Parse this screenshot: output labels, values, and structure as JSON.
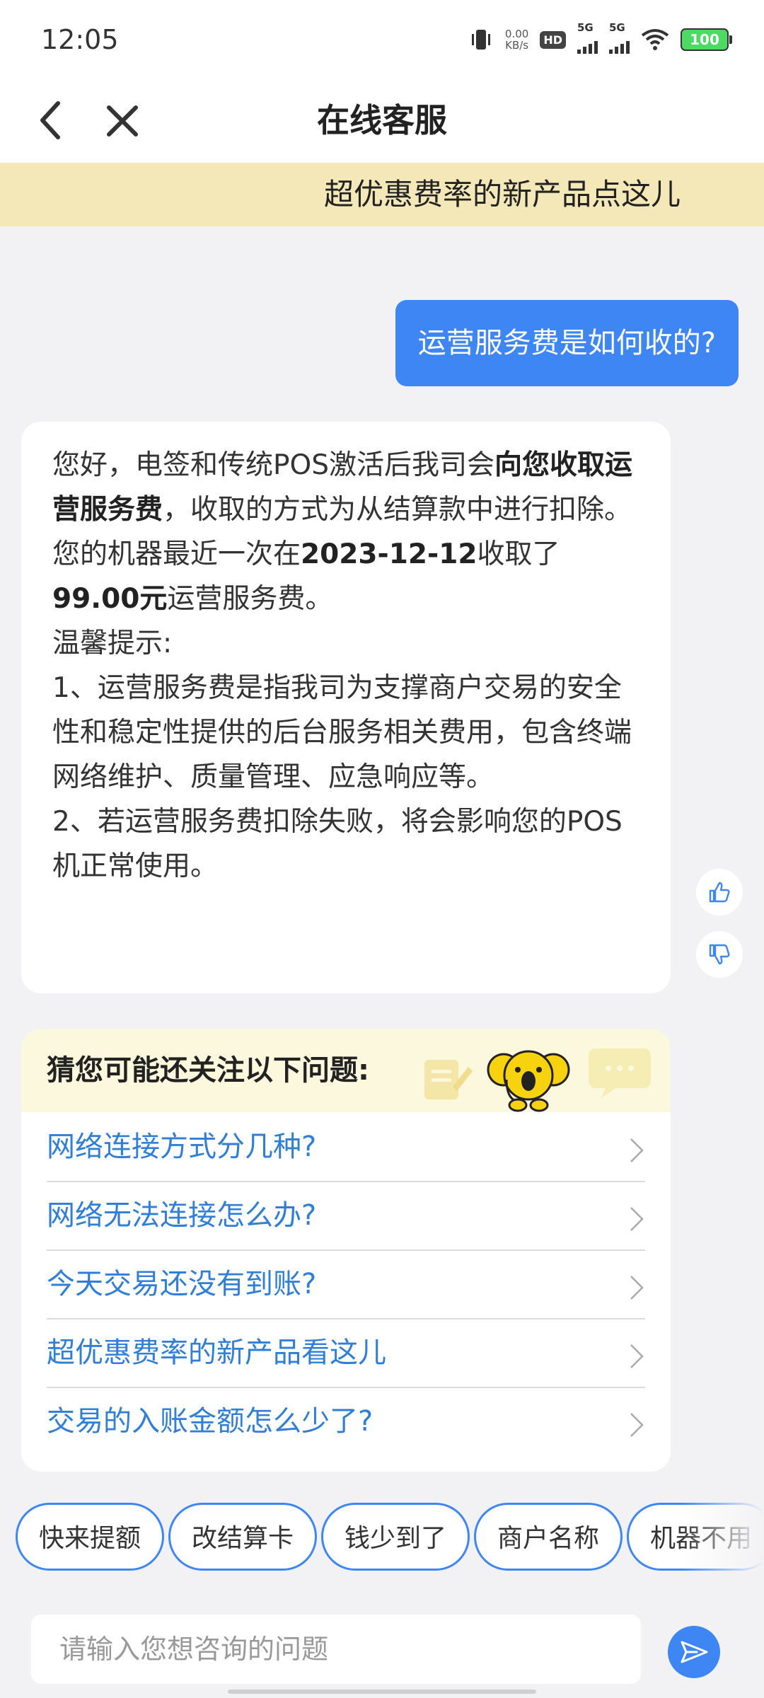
{
  "status_bar": {
    "time": "12:05",
    "net_speed_value": "0.00",
    "net_speed_unit": "KB/s",
    "hd_label": "HD",
    "signal1_label": "5G",
    "signal2_label": "5G",
    "battery": "100",
    "icons": [
      "vibrate-icon",
      "wifi-icon",
      "battery-icon"
    ]
  },
  "header": {
    "title": "在线客服",
    "back_icon": "chevron-left-icon",
    "close_icon": "close-icon"
  },
  "promo": {
    "text": "超优惠费率的新产品点这儿"
  },
  "user_message": {
    "text": "运营服务费是如何收的?"
  },
  "bot_message": {
    "p1_a": "您好，电签和传统POS激活后我司会",
    "p1_b": "向您收取运营服务费",
    "p1_c": "，收取的方式为从结算款中进行扣除。",
    "p2_a": "您的机器最近一次在",
    "p2_date": "2023-12-12",
    "p2_b": "收取了",
    "p2_amount": "99.00元",
    "p2_c": "运营服务费。",
    "p3": "温馨提示:",
    "p4": "1、运营服务费是指我司为支撑商户交易的安全性和稳定性提供的后台服务相关费用，包含终端网络维护、质量管理、应急响应等。",
    "p5": "2、若运营服务费扣除失败，将会影响您的POS机正常使用。"
  },
  "feedback": {
    "like_icon": "thumbs-up-icon",
    "dislike_icon": "thumbs-down-icon"
  },
  "suggestions": {
    "title": "猜您可能还关注以下问题:",
    "items": [
      {
        "label": "网络连接方式分几种?"
      },
      {
        "label": "网络无法连接怎么办?"
      },
      {
        "label": "今天交易还没有到账?"
      },
      {
        "label": "超优惠费率的新产品看这儿"
      },
      {
        "label": "交易的入账金额怎么少了?"
      }
    ]
  },
  "quick_chips": [
    {
      "label": "快来提额"
    },
    {
      "label": "改结算卡"
    },
    {
      "label": "钱少到了"
    },
    {
      "label": "商户名称"
    },
    {
      "label": "机器不用"
    }
  ],
  "input": {
    "placeholder": "请输入您想咨询的问题",
    "send_icon": "send-icon"
  },
  "colors": {
    "accent": "#3d86f4",
    "banner": "#f5e8b8",
    "link": "#2f7ed8",
    "suggestion_header": "#fbf8dd"
  }
}
